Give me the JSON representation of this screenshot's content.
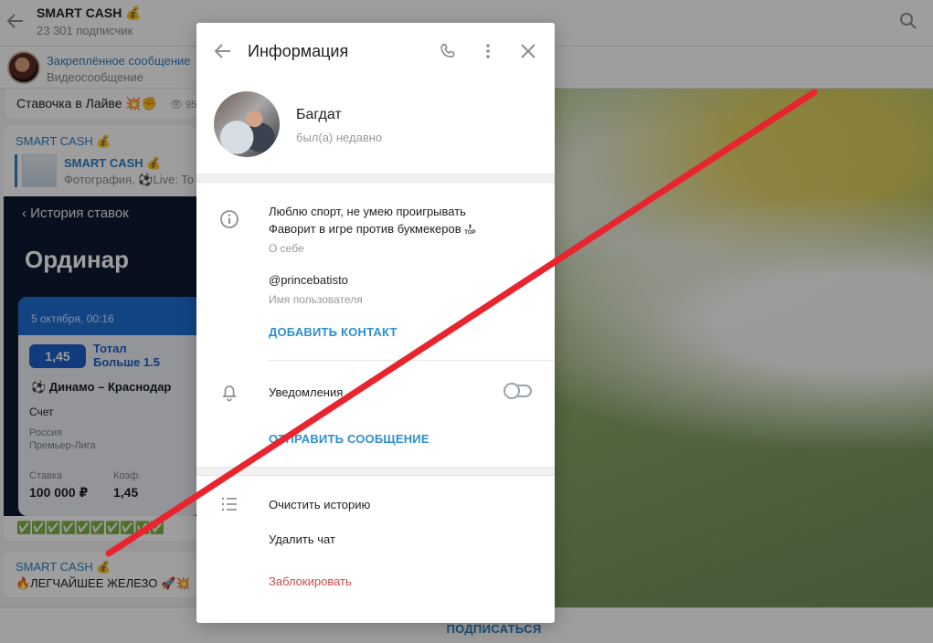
{
  "channel": {
    "title": "SMART CASH 💰",
    "subscribers": "23 301 подписчик"
  },
  "pinned": {
    "title": "Закреплённое сообщение",
    "subtitle": "Видеосообщение"
  },
  "messages": {
    "m1_text": "Ставочка в Лайве 💥✊",
    "m1_views": "95",
    "m2_author": "SMART CASH 💰",
    "m2_fwd_title": "SMART CASH 💰",
    "m2_fwd_sub": "Фотография, ⚽Live: To",
    "m3_author": "SMART CASH 💰",
    "m3_text": "🔥ЛЕГЧАЙШЕЕ ЖЕЛЕЗО 🚀💥"
  },
  "bet_screenshot": {
    "back_label": "История ставок",
    "heading": "Ординар",
    "date": "5 октября, 00:16",
    "odd": "1,45",
    "market_line1": "Тотал",
    "market_line2": "Больше 1.5",
    "match": "Динамо – Краснодар",
    "score_label": "Счет",
    "league_line1": "Россия",
    "league_line2": "Премьер-Лига",
    "stake_label": "Ставка",
    "stake_value": "100 000 ₽",
    "coef_label": "Коэф.",
    "coef_value": "1,45"
  },
  "checks": "✅✅✅✅✅✅✅✅✅✅",
  "subscribe_label": "ПОДПИСАТЬСЯ",
  "modal": {
    "title": "Информация",
    "name": "Багдат",
    "status": "был(а) недавно",
    "bio_line1": "Люблю спорт, не умею проигрывать",
    "bio_line2": "Фаворит в игре против букмекеров",
    "bio_label": "О себе",
    "username": "@princebatisto",
    "username_label": "Имя пользователя",
    "add_contact": "ДОБАВИТЬ КОНТАКТ",
    "notifications": "Уведомления",
    "notifications_on": false,
    "send_message": "ОТПРАВИТЬ СООБЩЕНИЕ",
    "clear_history": "Очистить историю",
    "delete_chat": "Удалить чат",
    "block": "Заблокировать"
  },
  "colors": {
    "accent": "#2e8fcf",
    "danger": "#cc4b4b",
    "overlay_line": "#e8252f"
  }
}
